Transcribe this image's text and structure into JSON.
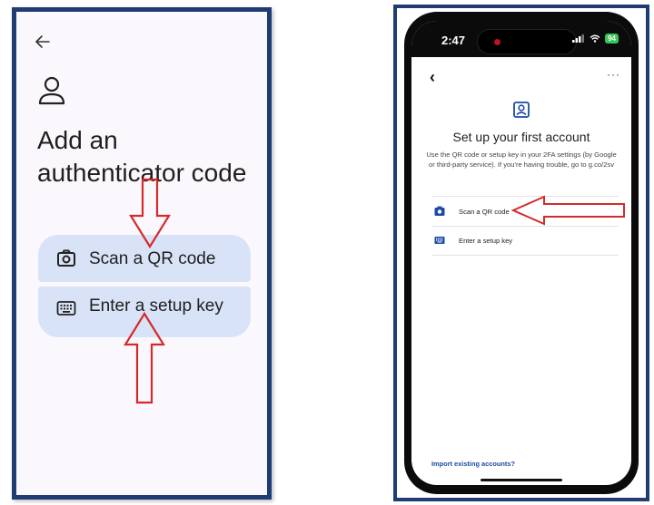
{
  "left_panel": {
    "title": "Add an authenticator code",
    "options": [
      {
        "label": "Scan a QR code",
        "icon": "camera-icon"
      },
      {
        "label": "Enter a setup key",
        "icon": "keyboard-icon"
      }
    ],
    "colors": {
      "border": "#1f3d73",
      "option_bg": "#d9e3f8",
      "arrow": "#d42a2a"
    }
  },
  "right_panel": {
    "status_time": "2:47",
    "battery": "94",
    "title": "Set up your first account",
    "description": "Use the QR code or setup key in your 2FA settings (by Google or third-party service). If you're having trouble, go to g.co/2sv",
    "options": [
      {
        "label": "Scan a QR code",
        "icon": "camera-icon"
      },
      {
        "label": "Enter a setup key",
        "icon": "keyboard-icon"
      }
    ],
    "import_link": "Import existing accounts?",
    "more_menu": "···"
  }
}
